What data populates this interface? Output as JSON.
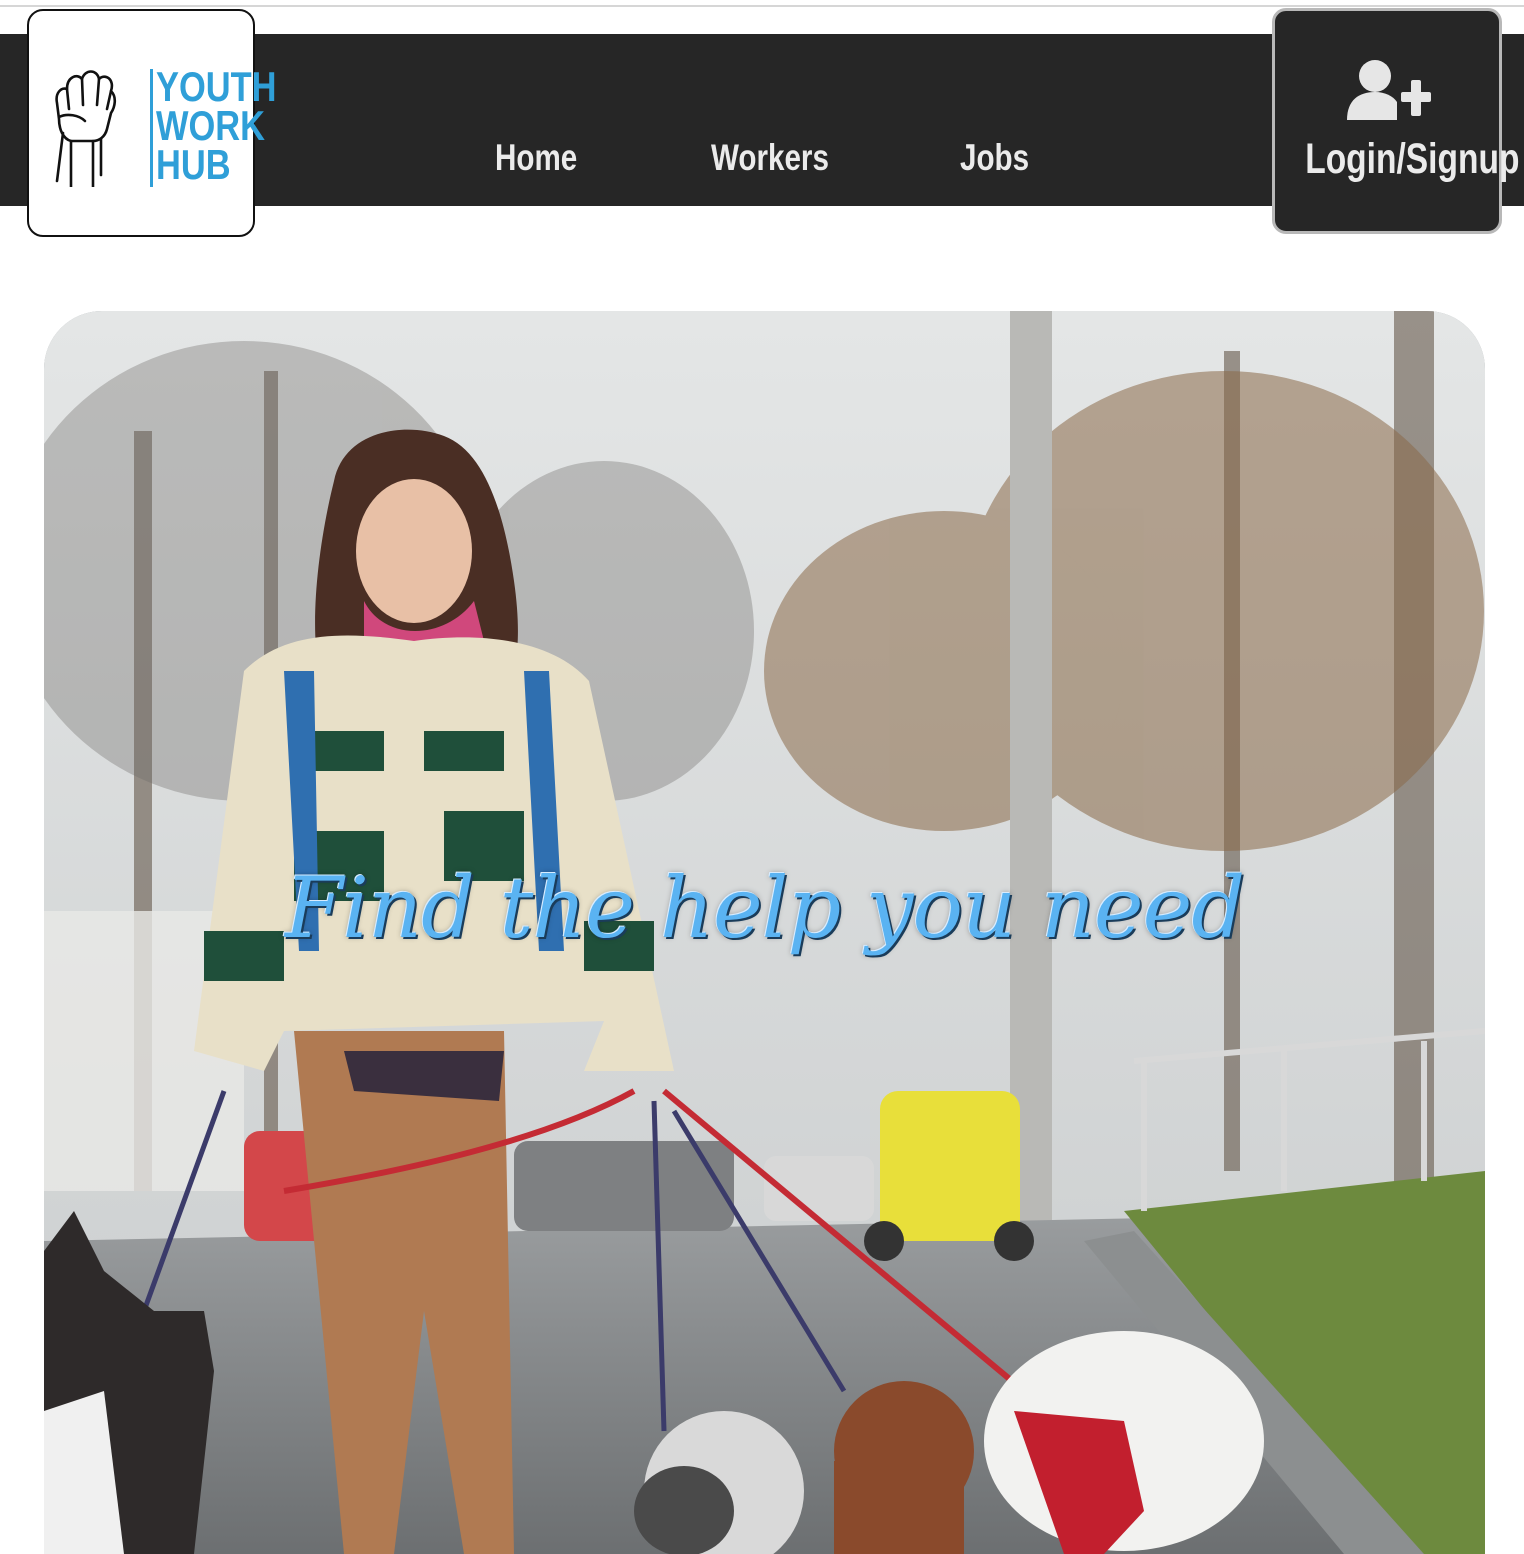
{
  "header": {
    "logo": {
      "lines": [
        "YOUTH",
        "WORK",
        "HUB"
      ],
      "icon": "raised-fist-icon",
      "brand_color": "#2f9fd8"
    },
    "nav": [
      {
        "label": "Home"
      },
      {
        "label": "Workers"
      },
      {
        "label": "Jobs"
      }
    ],
    "login": {
      "label": "Login/Signup",
      "icon": "add-user-icon"
    },
    "bar_color": "#262626"
  },
  "hero": {
    "tagline": "Find the help you need",
    "tagline_color": "#5ab3f2",
    "image": "woman-walking-dogs-photo"
  }
}
